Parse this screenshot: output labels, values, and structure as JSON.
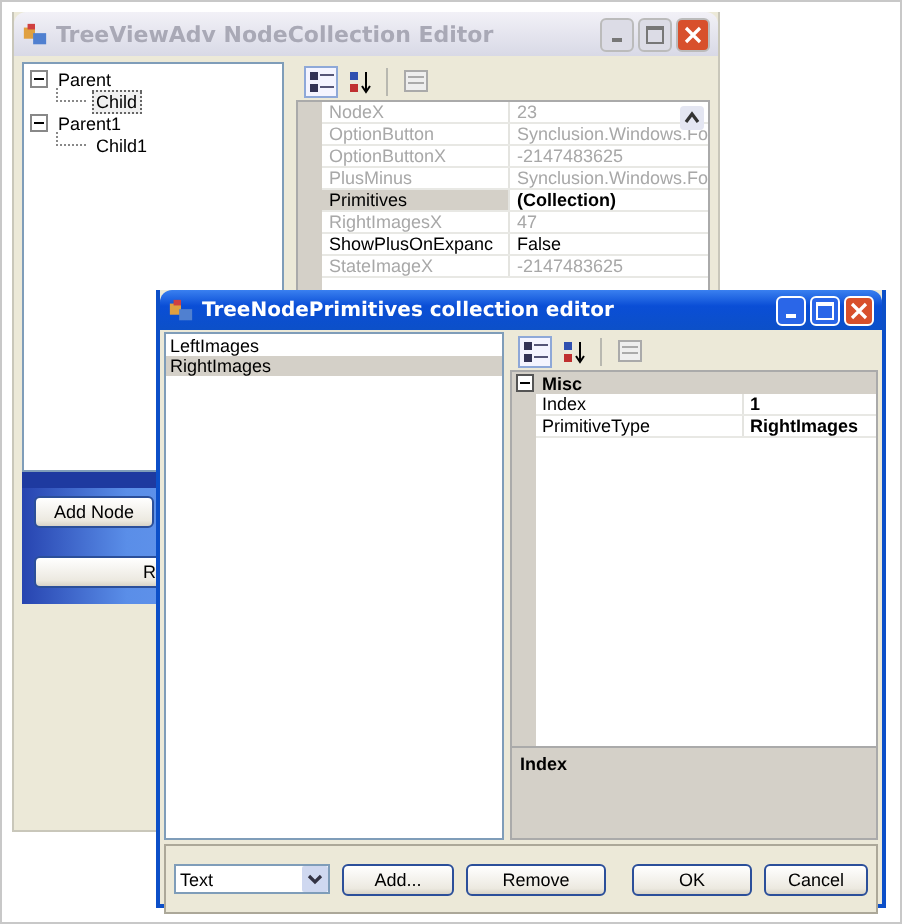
{
  "back_window": {
    "title": "TreeViewAdv NodeCollection Editor",
    "tree": [
      {
        "label": "Parent",
        "expanded": true,
        "selected": false,
        "children": [
          {
            "label": "Child",
            "selected": true
          }
        ]
      },
      {
        "label": "Parent1",
        "expanded": true,
        "selected": false,
        "children": [
          {
            "label": "Child1",
            "selected": false
          }
        ]
      }
    ],
    "properties": [
      {
        "name": "NodeX",
        "value": "23",
        "disabled": true,
        "selected": false
      },
      {
        "name": "OptionButton",
        "value": "Synclusion.Windows.Fo",
        "disabled": true,
        "selected": false
      },
      {
        "name": "OptionButtonX",
        "value": "-2147483625",
        "disabled": true,
        "selected": false
      },
      {
        "name": "PlusMinus",
        "value": "Synclusion.Windows.Fo",
        "disabled": true,
        "selected": false
      },
      {
        "name": "Primitives",
        "value": "(Collection)",
        "disabled": false,
        "selected": true
      },
      {
        "name": "RightImagesX",
        "value": "47",
        "disabled": true,
        "selected": false
      },
      {
        "name": "ShowPlusOnExpanc",
        "value": "False",
        "disabled": false,
        "selected": false
      },
      {
        "name": "StateImageX",
        "value": "-2147483625",
        "disabled": true,
        "selected": false
      }
    ],
    "buttons": [
      "Add Node",
      "R"
    ]
  },
  "front_window": {
    "title": "TreeNodePrimitives collection editor",
    "members": [
      {
        "label": "LeftImages",
        "selected": false
      },
      {
        "label": "RightImages",
        "selected": true
      }
    ],
    "category": {
      "label": "Misc",
      "expanded": true
    },
    "properties": [
      {
        "name": "Index",
        "value": "1"
      },
      {
        "name": "PrimitiveType",
        "value": "RightImages"
      }
    ],
    "description_title": "Index",
    "type_combo": {
      "value": "Text"
    },
    "buttons": [
      "Add...",
      "Remove",
      "OK",
      "Cancel"
    ]
  }
}
